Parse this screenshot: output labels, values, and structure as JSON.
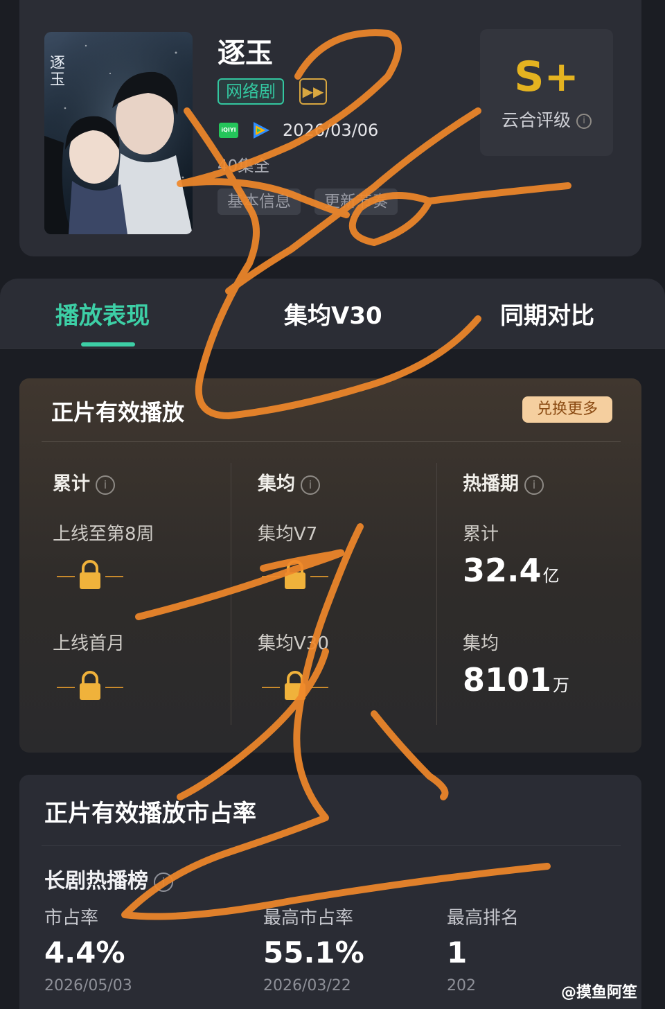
{
  "drama": {
    "title": "逐玉",
    "genre_tag": "网络剧",
    "play_icon": "play-forward-icon",
    "platforms": [
      "iqiyi-icon",
      "tencent-video-icon"
    ],
    "iqiyi_text": "iQIYI",
    "air_date": "2026/03/06",
    "episodes": "40集全",
    "buttons": [
      "基本信息",
      "更新节奏"
    ],
    "poster_text": "逐玉"
  },
  "rating": {
    "grade": "S+",
    "label": "云合评级",
    "info_icon": "info-icon",
    "grade_color": "#e4b320"
  },
  "tabs": [
    "播放表现",
    "集均V30",
    "同期对比"
  ],
  "plays": {
    "title": "正片有效播放",
    "exchange_label": "兑换更多",
    "col_cumulative": {
      "head": "累计",
      "row1_label": "上线至第8周",
      "row2_label": "上线首月"
    },
    "col_episode_avg": {
      "head": "集均",
      "row1_label": "集均V7",
      "row2_label": "集均V30"
    },
    "col_hot": {
      "head": "热播期",
      "total_label": "累计",
      "total_value": "32.4",
      "total_unit": "亿",
      "avg_label": "集均",
      "avg_value": "8101",
      "avg_unit": "万"
    },
    "locked_icon": "lock-icon"
  },
  "share": {
    "title": "正片有效播放市占率",
    "board": "长剧热播榜",
    "stats": [
      {
        "label": "市占率",
        "value": "4.4%",
        "date": "2026/05/03"
      },
      {
        "label": "最高市占率",
        "value": "55.1%",
        "date": "2026/03/22"
      },
      {
        "label": "最高排名",
        "value": "1",
        "date": "202"
      }
    ]
  },
  "credit": "@摸鱼阿笙",
  "colors": {
    "accent": "#3dcfa6",
    "scribble": "#f0882a",
    "exchange_bg": "#f5cf9f"
  }
}
